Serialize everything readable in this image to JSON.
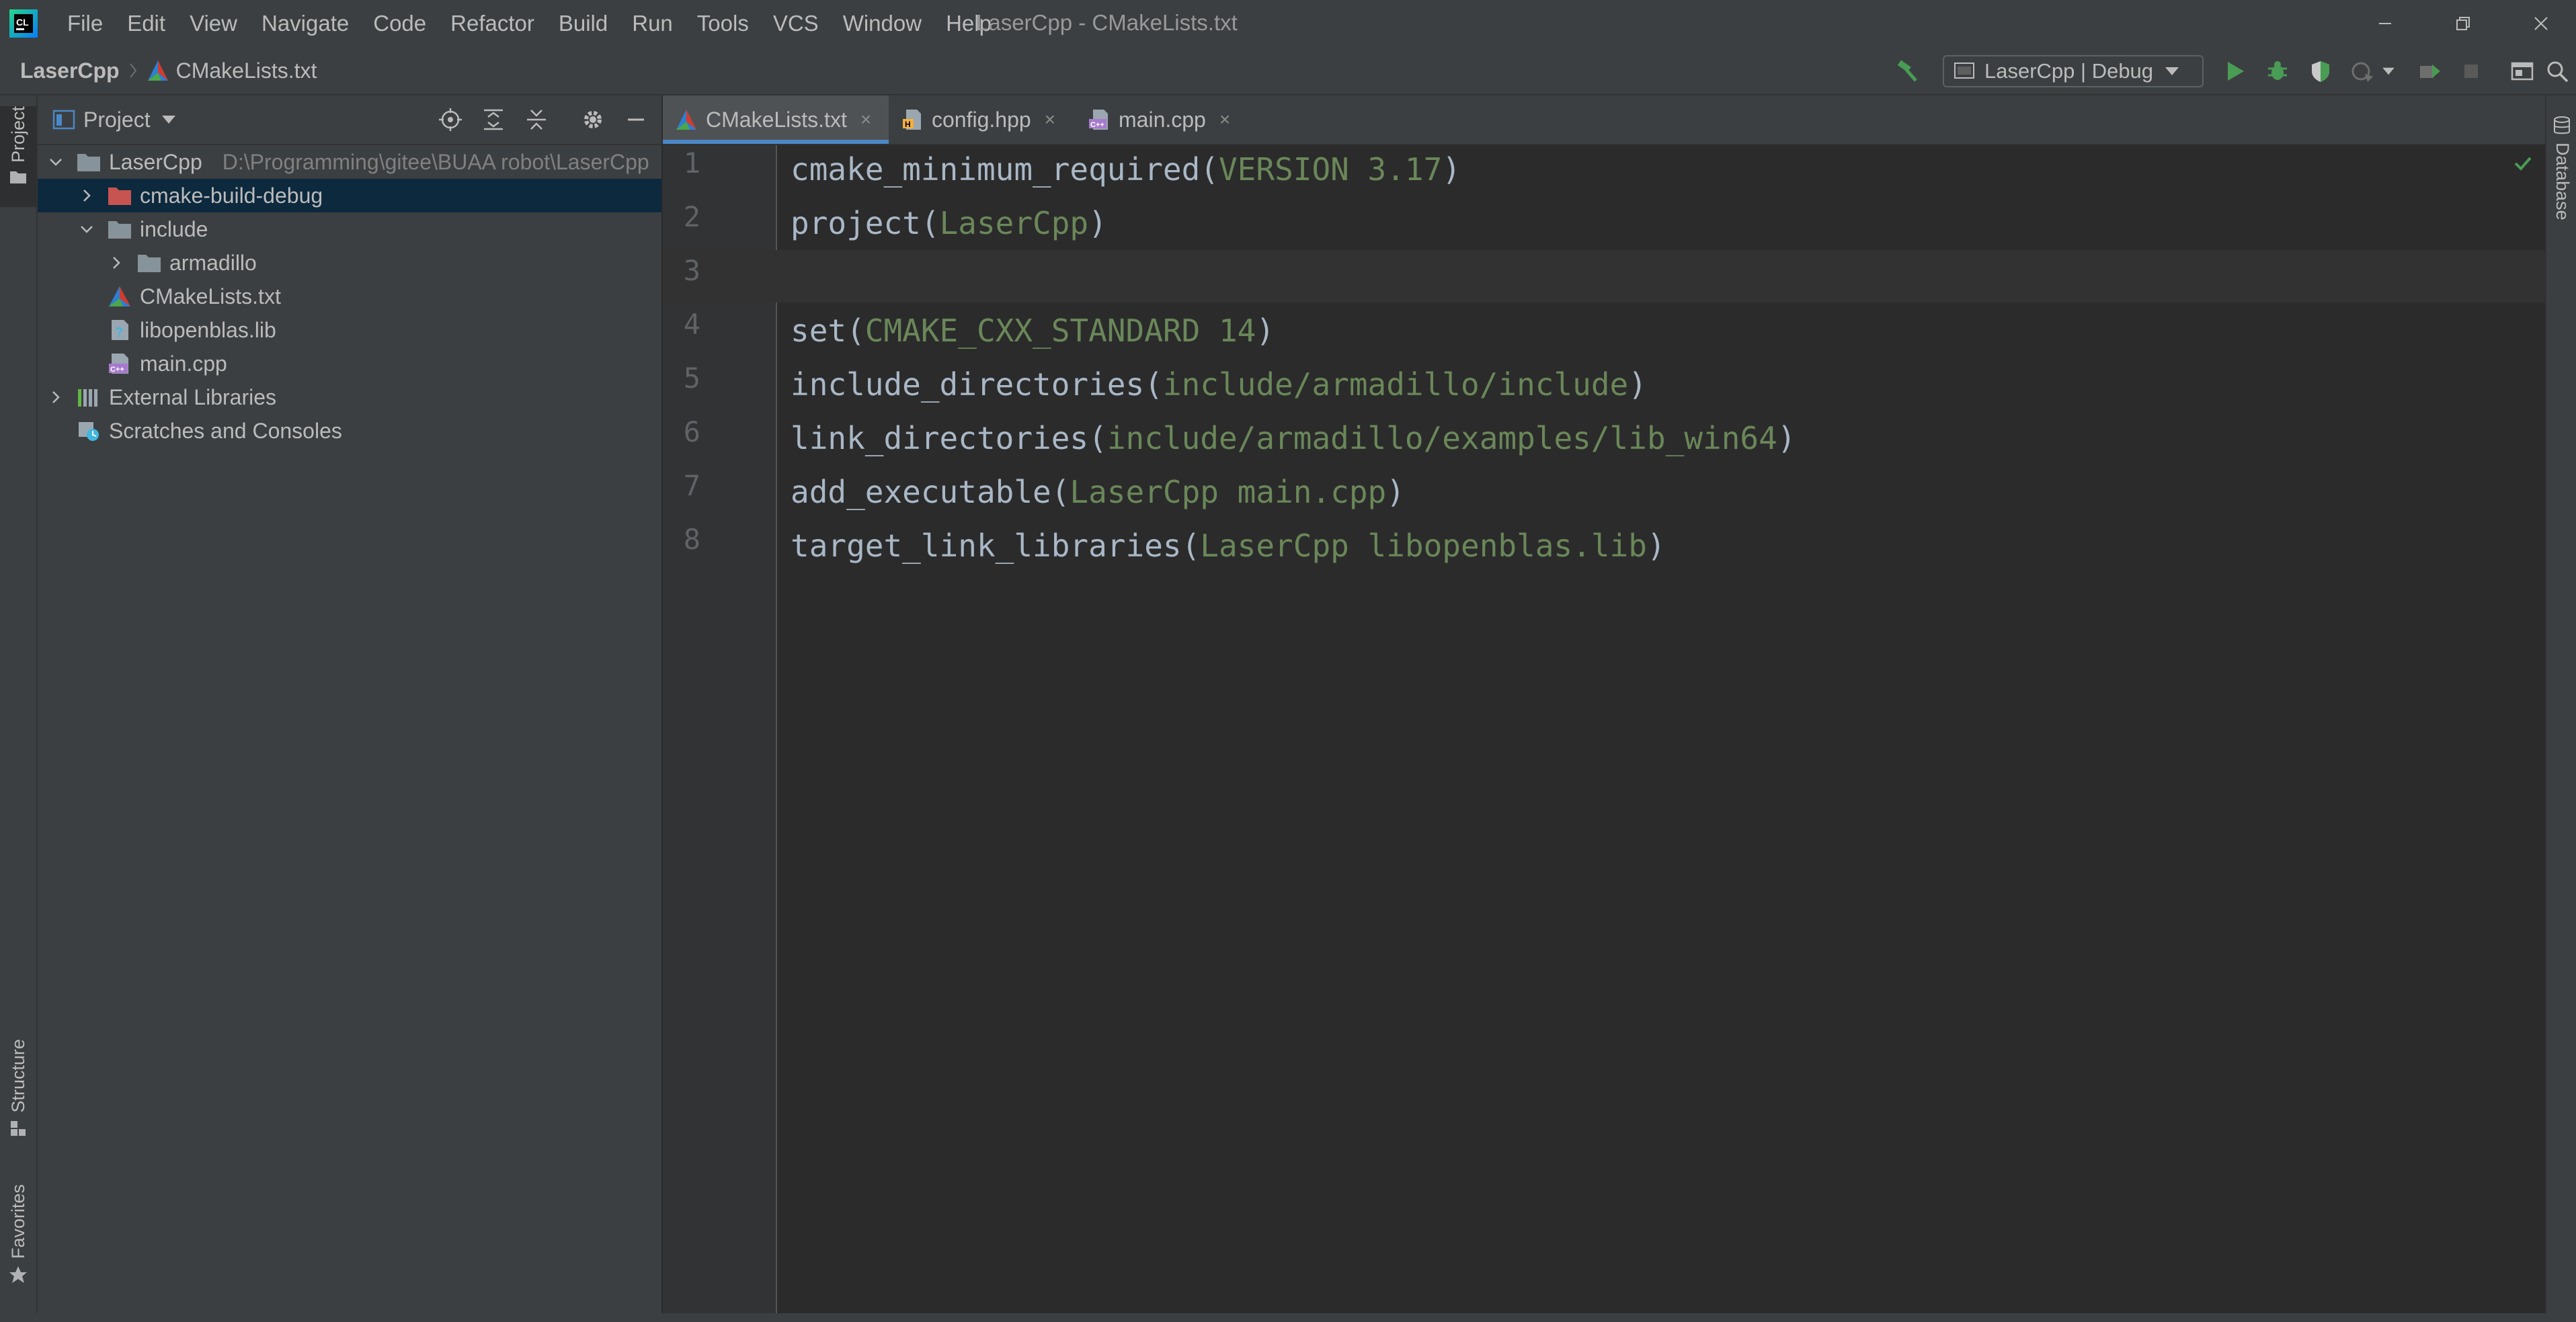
{
  "menu": {
    "items": [
      "File",
      "Edit",
      "View",
      "Navigate",
      "Code",
      "Refactor",
      "Build",
      "Run",
      "Tools",
      "VCS",
      "Window",
      "Help"
    ]
  },
  "window": {
    "title": "LaserCpp - CMakeLists.txt"
  },
  "breadcrumb": {
    "project": "LaserCpp",
    "file": "CMakeLists.txt"
  },
  "toolbar": {
    "run_config": "LaserCpp | Debug"
  },
  "left_strip": {
    "project_tab": "Project",
    "structure_tab": "Structure",
    "favorites_tab": "Favorites"
  },
  "right_strip": {
    "database_tab": "Database"
  },
  "project_panel": {
    "title": "Project",
    "tree": [
      {
        "label": "LaserCpp",
        "path": "D:\\Programming\\gitee\\BUAA robot\\LaserCpp"
      },
      {
        "label": "cmake-build-debug"
      },
      {
        "label": "include"
      },
      {
        "label": "armadillo"
      },
      {
        "label": "CMakeLists.txt"
      },
      {
        "label": "libopenblas.lib"
      },
      {
        "label": "main.cpp"
      },
      {
        "label": "External Libraries"
      },
      {
        "label": "Scratches and Consoles"
      }
    ]
  },
  "editor": {
    "tabs": [
      {
        "label": "CMakeLists.txt",
        "active": true
      },
      {
        "label": "config.hpp",
        "active": false
      },
      {
        "label": "main.cpp",
        "active": false
      }
    ],
    "close_glyph": "×",
    "line_numbers": [
      "1",
      "2",
      "3",
      "4",
      "5",
      "6",
      "7",
      "8"
    ],
    "lines": [
      {
        "fn": "cmake_minimum_required(",
        "arg": "VERSION 3.17",
        "end": ")"
      },
      {
        "fn": "project(",
        "arg": "LaserCpp",
        "end": ")"
      },
      {
        "fn": "",
        "arg": "",
        "end": ""
      },
      {
        "fn": "set(",
        "arg": "CMAKE_CXX_STANDARD 14",
        "end": ")"
      },
      {
        "fn": "include_directories(",
        "arg": "include/armadillo/include",
        "end": ")"
      },
      {
        "fn": "link_directories(",
        "arg": "include/armadillo/examples/lib_win64",
        "end": ")"
      },
      {
        "fn": "add_executable(",
        "arg": "LaserCpp main.cpp",
        "end": ")"
      },
      {
        "fn": "target_link_libraries(",
        "arg": "LaserCpp libopenblas.lib",
        "end": ")"
      }
    ]
  },
  "colors": {
    "background": "#2b2b2b",
    "panel": "#3c3f41",
    "selection": "#0d293e",
    "code_text": "#a9b7c6",
    "code_string": "#6a8759",
    "active_tab_underline": "#4a88c7",
    "run_green": "#499c54"
  }
}
